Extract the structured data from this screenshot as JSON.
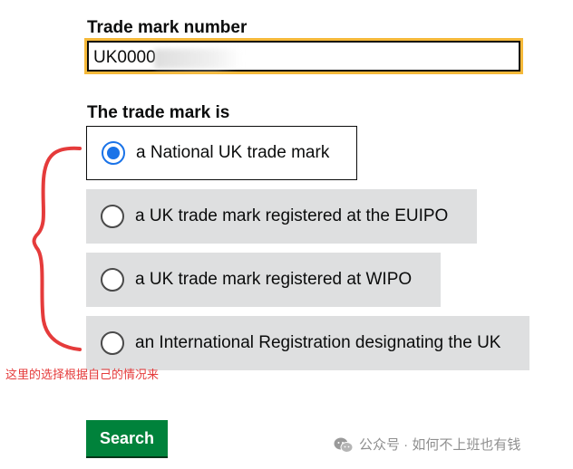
{
  "form": {
    "number_label": "Trade mark number",
    "number_value": "UK0000",
    "legend": "The trade mark is",
    "options": [
      {
        "label": "a National UK trade mark",
        "selected": true
      },
      {
        "label": "a UK trade mark registered at the EUIPO",
        "selected": false
      },
      {
        "label": "a UK trade mark registered at WIPO",
        "selected": false
      },
      {
        "label": "an International Registration designating the UK",
        "selected": false
      }
    ],
    "search_label": "Search"
  },
  "annotation": {
    "note": "这里的选择根据自己的情况来",
    "color": "#e53b3b"
  },
  "watermark": {
    "text": "公众号 · 如何不上班也有钱",
    "icon": "wechat-icon"
  },
  "colors": {
    "focus": "#f5b93a",
    "button": "#00823b",
    "radio_selected": "#1a73e8",
    "option_bg": "#dedfe0"
  }
}
